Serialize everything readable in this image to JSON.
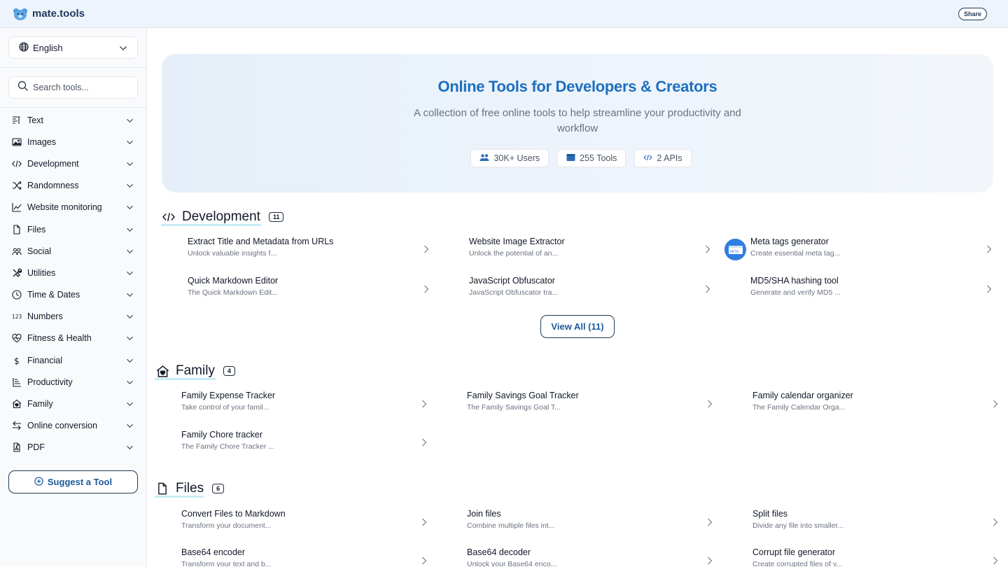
{
  "header": {
    "logo_text": "mate.tools",
    "share_label": "Share"
  },
  "sidebar": {
    "language": "English",
    "search_placeholder": "Search tools...",
    "categories": [
      {
        "label": "Text",
        "icon": "text-icon"
      },
      {
        "label": "Images",
        "icon": "image-icon"
      },
      {
        "label": "Development",
        "icon": "code-icon"
      },
      {
        "label": "Randomness",
        "icon": "shuffle-icon"
      },
      {
        "label": "Website monitoring",
        "icon": "chart-line-icon"
      },
      {
        "label": "Files",
        "icon": "file-icon"
      },
      {
        "label": "Social",
        "icon": "users-icon"
      },
      {
        "label": "Utilities",
        "icon": "tools-icon"
      },
      {
        "label": "Time & Dates",
        "icon": "clock-icon"
      },
      {
        "label": "Numbers",
        "icon": "numbers-icon"
      },
      {
        "label": "Fitness & Health",
        "icon": "heart-pulse-icon"
      },
      {
        "label": "Financial",
        "icon": "dollar-icon"
      },
      {
        "label": "Productivity",
        "icon": "productivity-icon"
      },
      {
        "label": "Family",
        "icon": "home-heart-icon"
      },
      {
        "label": "Online conversion",
        "icon": "arrows-exchange-icon"
      },
      {
        "label": "PDF",
        "icon": "pdf-icon"
      }
    ],
    "suggest_label": "Suggest a Tool"
  },
  "hero": {
    "title": "Online Tools for Developers & Creators",
    "subtitle": "A collection of free online tools to help streamline your productivity and workflow",
    "badges": [
      {
        "label": "30K+ Users",
        "icon": "users-icon"
      },
      {
        "label": "255 Tools",
        "icon": "toolbox-icon"
      },
      {
        "label": "2 APIs",
        "icon": "code-icon"
      }
    ]
  },
  "sections": {
    "development": {
      "title": "Development",
      "count": "11",
      "tools": [
        {
          "name": "Extract Title and Metadata from URLs",
          "desc": "Unlock valuable insights f..."
        },
        {
          "name": "Website Image Extractor",
          "desc": "Unlock the potential of an..."
        },
        {
          "name": "Meta tags generator",
          "desc": "Create essential meta tag..."
        },
        {
          "name": "Quick Markdown Editor",
          "desc": "The Quick Markdown Edit..."
        },
        {
          "name": "JavaScript Obfuscator",
          "desc": "JavaScript Obfuscator tra..."
        },
        {
          "name": "MD5/SHA hashing tool",
          "desc": "Generate and verify MD5 ..."
        }
      ],
      "view_all": "View All (11)"
    },
    "family": {
      "title": "Family",
      "count": "4",
      "tools": [
        {
          "name": "Family Expense Tracker",
          "desc": "Take control of your famil..."
        },
        {
          "name": "Family Savings Goal Tracker",
          "desc": "The Family Savings Goal T..."
        },
        {
          "name": "Family calendar organizer",
          "desc": "The Family Calendar Orga..."
        },
        {
          "name": "Family Chore tracker",
          "desc": "The Family Chore Tracker ..."
        }
      ]
    },
    "files": {
      "title": "Files",
      "count": "6",
      "tools": [
        {
          "name": "Convert Files to Markdown",
          "desc": "Transform your document..."
        },
        {
          "name": "Join files",
          "desc": "Combine multiple files int..."
        },
        {
          "name": "Split files",
          "desc": "Divide any file into smaller..."
        },
        {
          "name": "Base64 encoder",
          "desc": "Transform your text and b..."
        },
        {
          "name": "Base64 decoder",
          "desc": "Unlock your Base64 enco..."
        },
        {
          "name": "Corrupt file generator",
          "desc": "Create corrupted files of v..."
        }
      ]
    }
  }
}
